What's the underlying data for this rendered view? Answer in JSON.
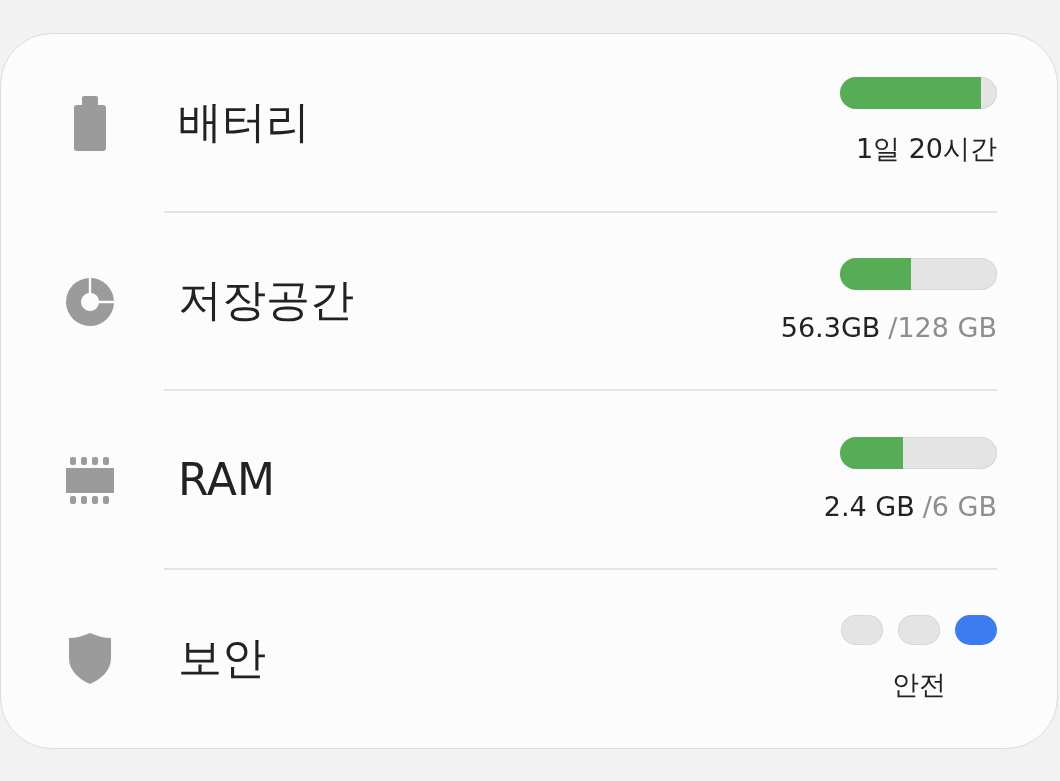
{
  "items": [
    {
      "kind": "bar",
      "label": "배터리",
      "level": 0.9,
      "reading": "1일 20시간"
    },
    {
      "kind": "bar",
      "label": "저장공간",
      "level": 0.45,
      "reading": "56.3GB",
      "total": "/128 GB"
    },
    {
      "kind": "bar",
      "label": "RAM",
      "level": 0.4,
      "reading": "2.4 GB",
      "total": "/6 GB"
    },
    {
      "kind": "segments",
      "label": "보안",
      "segments": [
        {
          "on": false
        },
        {
          "on": false
        },
        {
          "on": true
        }
      ],
      "reading": "안전"
    }
  ]
}
